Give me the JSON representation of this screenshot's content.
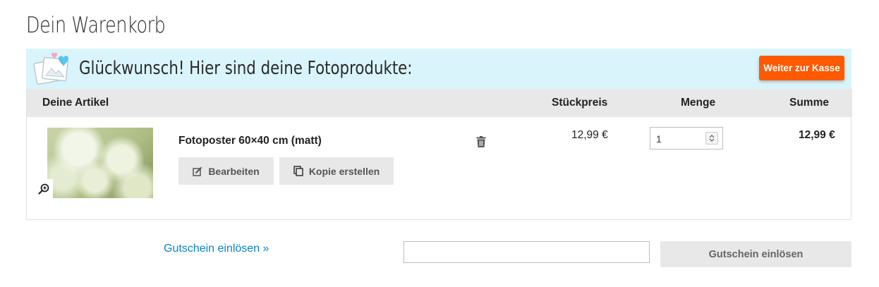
{
  "page": {
    "title": "Dein Warenkorb"
  },
  "banner": {
    "message": "Glückwunsch! Hier sind deine Fotoprodukte:",
    "checkout_label": "Weiter zur Kasse",
    "accent_color": "#ff5a00",
    "background_color": "#d9f5fb"
  },
  "table": {
    "headers": {
      "items": "Deine Artikel",
      "unit_price": "Stückpreis",
      "quantity": "Menge",
      "total": "Summe"
    }
  },
  "cart_items": [
    {
      "name": "Fotoposter 60×40 cm (matt)",
      "edit_label": "Bearbeiten",
      "copy_label": "Kopie erstellen",
      "unit_price": "12,99 €",
      "quantity": "1",
      "total": "12,99 €",
      "icons": {
        "zoom": "zoom-in-icon",
        "delete": "trash-icon",
        "edit": "edit-icon",
        "copy": "copy-icon"
      }
    }
  ],
  "voucher": {
    "link_label": "Gutschein einlösen »",
    "input_value": "",
    "button_label": "Gutschein einlösen",
    "link_color": "#0a85c8"
  }
}
